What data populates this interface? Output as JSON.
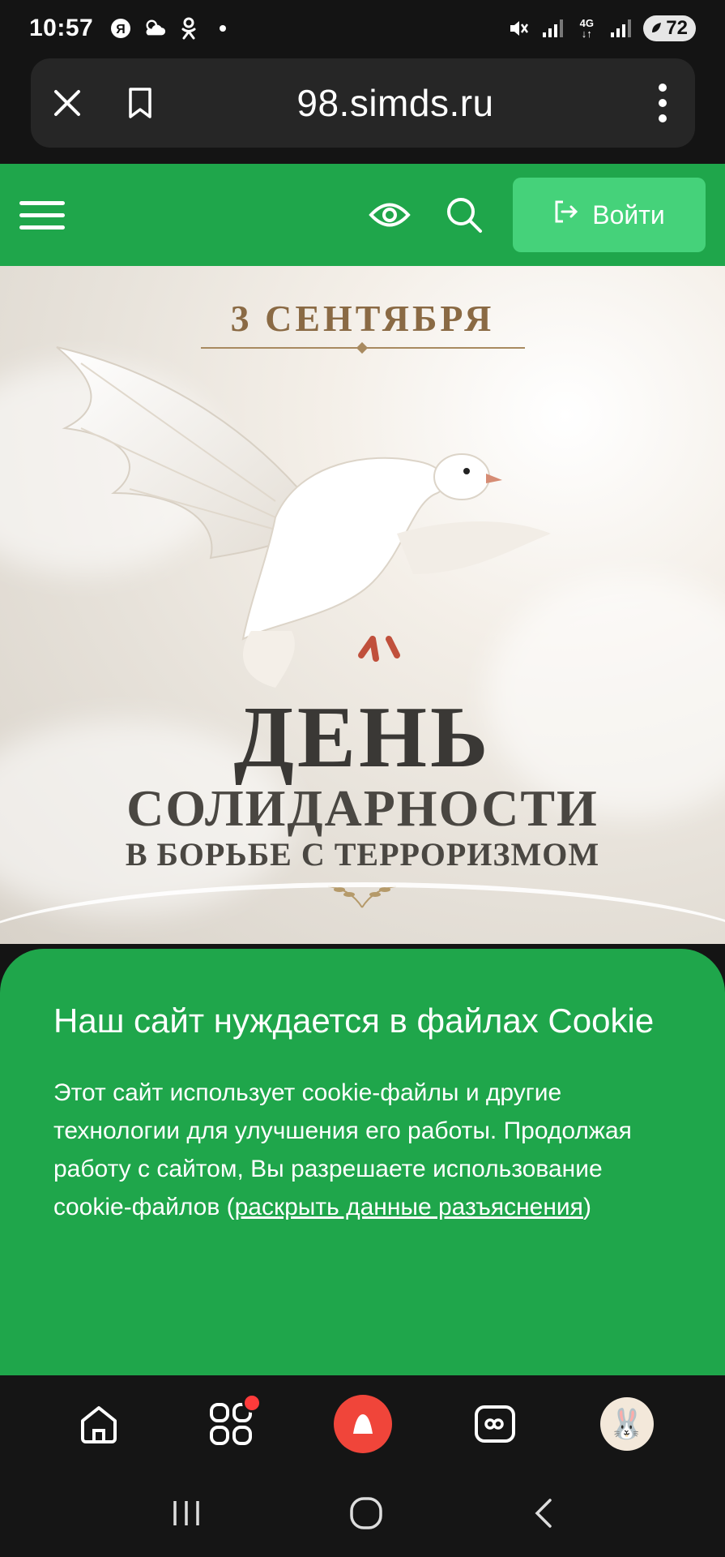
{
  "status_bar": {
    "time": "10:57",
    "battery": "72",
    "network": "4G"
  },
  "address_bar": {
    "url": "98.simds.ru"
  },
  "site_header": {
    "login_label": "Войти",
    "brand_color": "#1fa64b",
    "login_color": "#45d27a"
  },
  "banner": {
    "date": "3 СЕНТЯБРЯ",
    "title_line1": "ДЕНЬ",
    "title_line2": "СОЛИДАРНОСТИ",
    "title_line3": "В БОРЬБЕ С ТЕРРОРИЗМОМ"
  },
  "cookie_panel": {
    "title": "Наш сайт нуждается в файлах Cookie",
    "text": "Этот сайт использует cookie-файлы и другие технологии для улучшения его работы. Продолжая работу с сайтом, Вы разрешаете использование cookie-файлов (",
    "link": "раскрыть данные разъяснения",
    "text_end": ")"
  },
  "icons": {
    "close": "close-icon",
    "bookmark": "bookmark-icon",
    "more": "more-vertical-icon",
    "menu": "hamburger-icon",
    "eye": "eye-icon",
    "search": "search-icon",
    "login": "login-icon",
    "home": "home-icon",
    "apps": "apps-icon",
    "alice": "alice-icon",
    "tabs": "tabs-icon",
    "profile": "avatar"
  }
}
